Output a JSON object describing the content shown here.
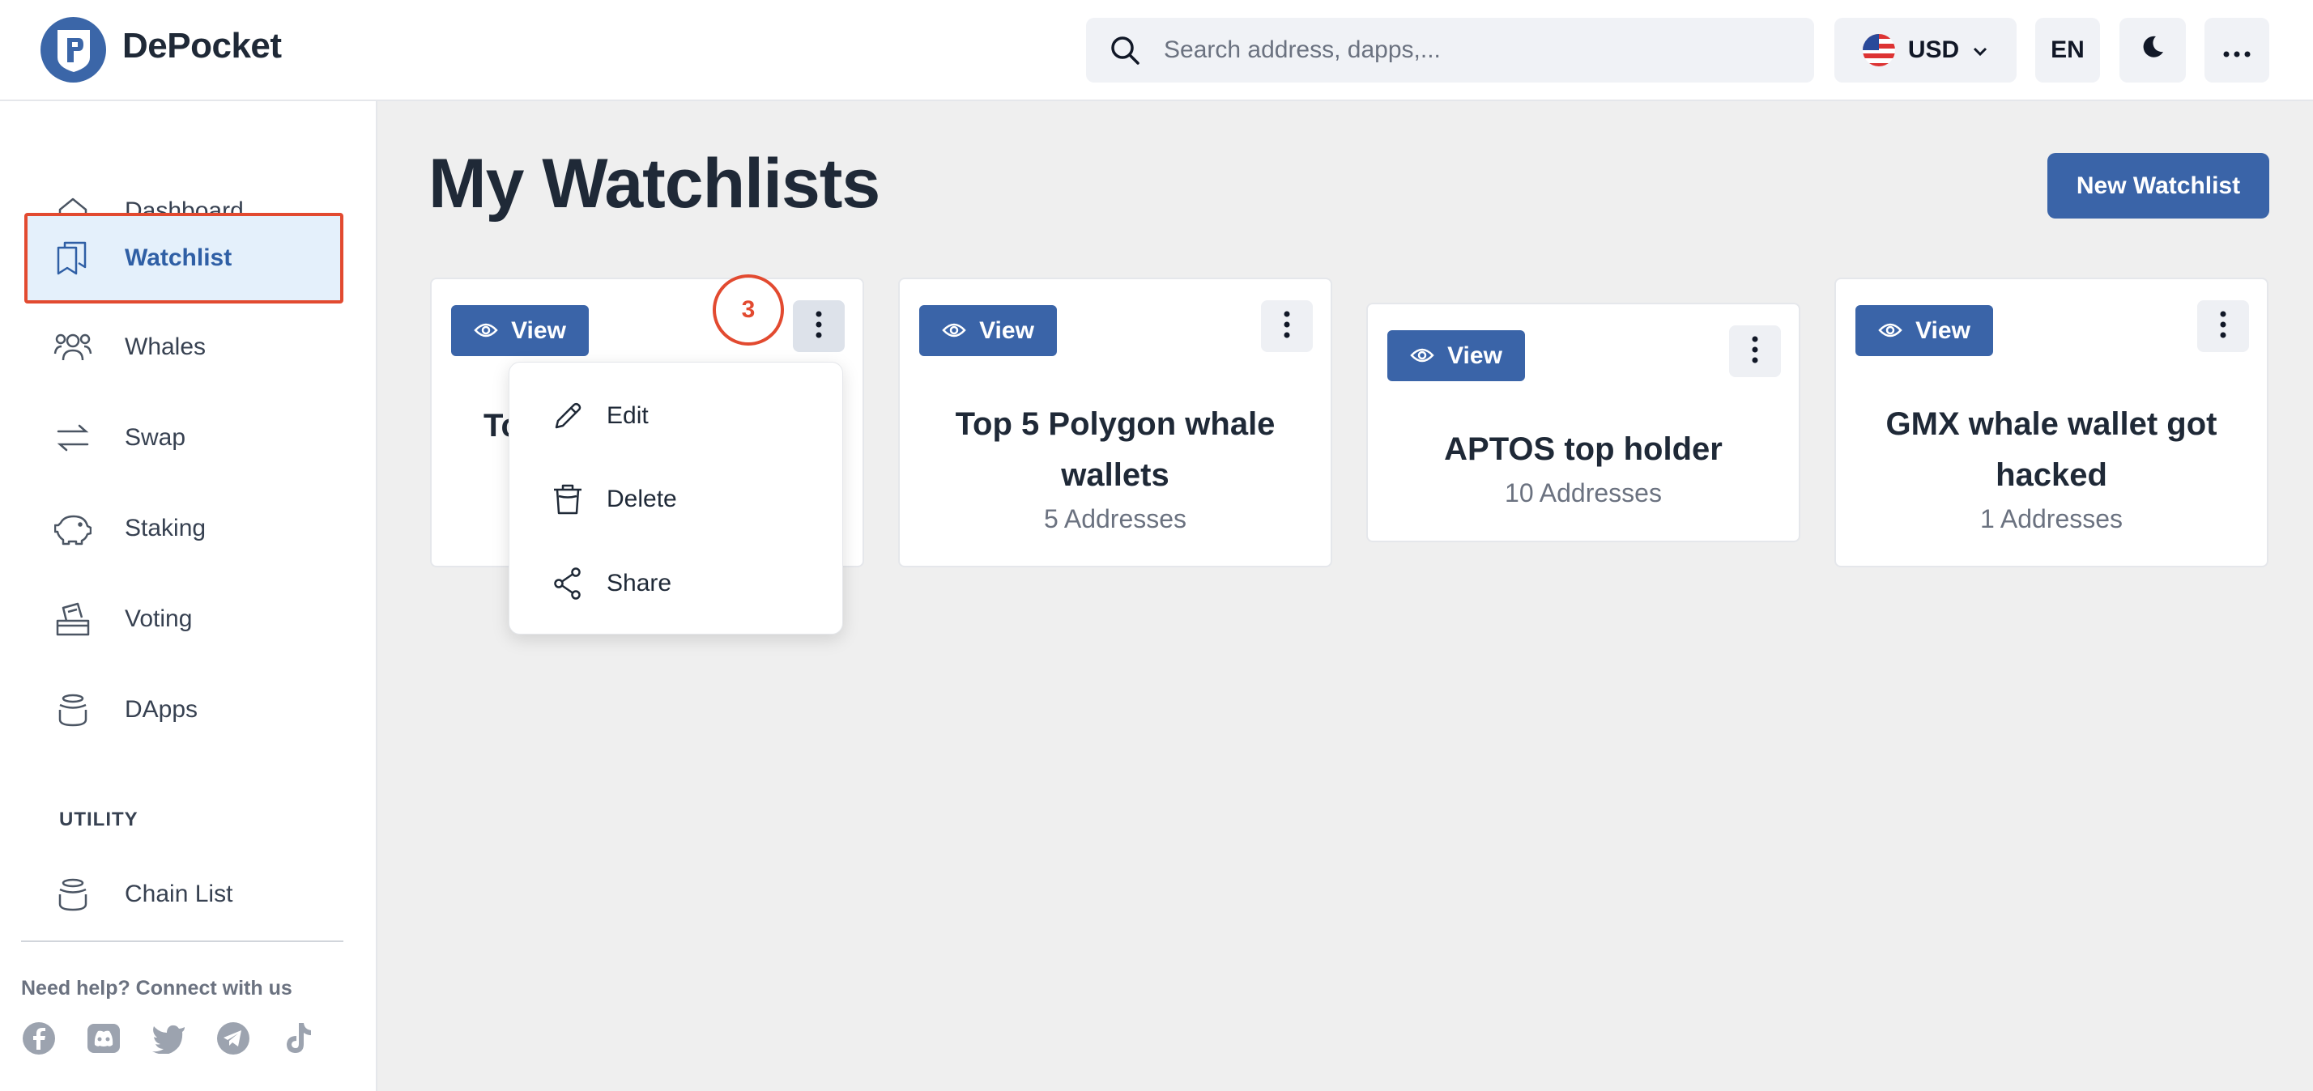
{
  "header": {
    "brand": "DePocket",
    "search_placeholder": "Search address, dapps,...",
    "currency": "USD",
    "language": "EN"
  },
  "sidebar": {
    "items": [
      {
        "label": "Dashboard",
        "icon": "home-icon"
      },
      {
        "label": "Watchlist",
        "icon": "bookmark-icon",
        "active": true
      },
      {
        "label": "Whales",
        "icon": "users-icon"
      },
      {
        "label": "Swap",
        "icon": "swap-icon"
      },
      {
        "label": "Staking",
        "icon": "piggy-bank-icon"
      },
      {
        "label": "Voting",
        "icon": "ballot-box-icon"
      },
      {
        "label": "DApps",
        "icon": "layers-icon"
      }
    ],
    "utility_title": "UTILITY",
    "utility_items": [
      {
        "label": "Chain List",
        "icon": "layers-icon"
      }
    ],
    "help_text": "Need help? Connect with us",
    "socials": [
      "facebook-icon",
      "discord-icon",
      "twitter-icon",
      "telegram-icon",
      "tiktok-icon"
    ]
  },
  "main": {
    "title": "My Watchlists",
    "new_button": "New Watchlist",
    "cards": [
      {
        "view_label": "View",
        "title": "Tc",
        "subtitle": ""
      },
      {
        "view_label": "View",
        "title": "Top 5 Polygon whale wallets",
        "subtitle": "5 Addresses"
      },
      {
        "view_label": "View",
        "title": "APTOS top holder",
        "subtitle": "10 Addresses"
      },
      {
        "view_label": "View",
        "title": "GMX whale wallet got hacked",
        "subtitle": "1 Addresses"
      }
    ],
    "step_marker": "3",
    "context_menu": [
      {
        "label": "Edit",
        "icon": "pencil-icon"
      },
      {
        "label": "Delete",
        "icon": "trash-icon"
      },
      {
        "label": "Share",
        "icon": "share-icon"
      }
    ]
  },
  "colors": {
    "accent": "#3a64a8",
    "highlight": "#e24a30",
    "active_bg": "#e4f0fb"
  }
}
